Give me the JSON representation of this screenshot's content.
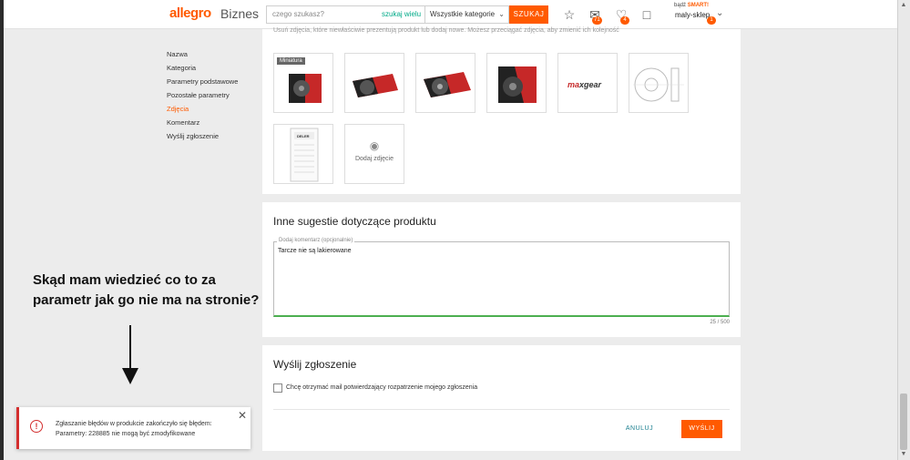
{
  "header": {
    "logo": "allegro",
    "logo_suffix": "Biznes",
    "search_placeholder": "czego szukasz?",
    "search_many": "szukaj wielu",
    "category": "Wszystkie kategorie",
    "search_button": "SZUKAJ",
    "messages_badge": "71",
    "notifications_badge": "4",
    "smart_prefix": "bądź",
    "smart_brand": "SMART!",
    "user_name": "maly-sklep",
    "user_badge": "1",
    "accent_color": "#ff5a00"
  },
  "sidebar": {
    "items": [
      {
        "label": "Nazwa"
      },
      {
        "label": "Kategoria"
      },
      {
        "label": "Parametry podstawowe"
      },
      {
        "label": "Pozostałe parametry"
      },
      {
        "label": "Zdjęcia",
        "active": true
      },
      {
        "label": "Komentarz"
      },
      {
        "label": "Wyślij zgłoszenie"
      }
    ]
  },
  "photos": {
    "hint": "Usuń zdjęcia, które niewłaściwie prezentują produkt lub dodaj nowe. Możesz przeciągać zdjęcia, aby zmienić ich kolejność",
    "miniature_label": "Miniatura",
    "brand_logo": "maxgear",
    "document_label": "DELER",
    "add_label": "Dodaj zdjęcie"
  },
  "comment": {
    "title": "Inne sugestie dotyczące produktu",
    "legend": "Dodaj komentarz (opcjonalnie)",
    "value": "Tarcze nie są lakierowane",
    "char_count": "25 / 500"
  },
  "submit": {
    "title": "Wyślij zgłoszenie",
    "checkbox_label": "Chcę otrzymać mail potwierdzający rozpatrzenie mojego zgłoszenia",
    "cancel": "ANULUJ",
    "send": "WYŚLIJ"
  },
  "annotation": {
    "text": "Skąd mam wiedzieć co to za parametr jak go nie ma na stronie?"
  },
  "toast": {
    "line1": "Zgłaszanie błędów w produkcie zakończyło się błędem:",
    "line2": "Parametry: 228885 nie mogą być zmodyfikowane",
    "error_color": "#d32f2f"
  }
}
